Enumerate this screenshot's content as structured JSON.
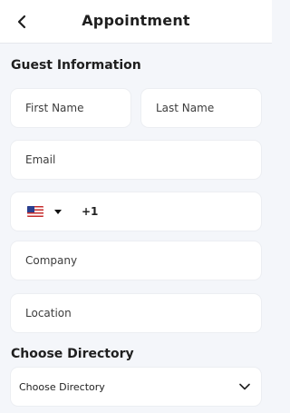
{
  "header": {
    "title": "Appointment"
  },
  "guest": {
    "section_title": "Guest Information",
    "first_name_placeholder": "First Name",
    "last_name_placeholder": "Last Name",
    "email_placeholder": "Email",
    "phone": {
      "country_icon": "us-flag-icon",
      "dial_code": "+1"
    },
    "company_placeholder": "Company",
    "location_placeholder": "Location"
  },
  "directory": {
    "section_title": "Choose Directory",
    "selected": "Choose Directory"
  },
  "colors": {
    "background": "#f4f6fa",
    "surface": "#ffffff",
    "text": "#1f1f1f"
  }
}
